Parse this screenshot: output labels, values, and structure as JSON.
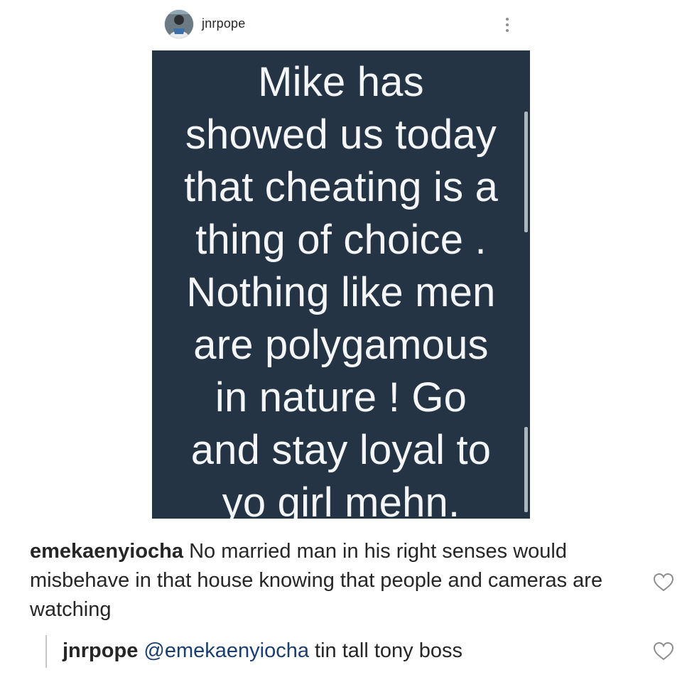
{
  "post": {
    "author": "jnrpope",
    "image_text": "Mike has\nshowed us today\nthat cheating is a\nthing of choice .\nNothing like men\nare polygamous\nin nature !  Go\nand stay loyal to\nyo girl mehn.",
    "image_background": "#243444"
  },
  "comments": [
    {
      "author": "emekaenyiocha",
      "text": "No married man in his right senses would misbehave in that house knowing that people and cameras are watching"
    }
  ],
  "reply": {
    "author": "jnrpope",
    "mention": "@emekaenyiocha",
    "text": "tin tall tony boss"
  },
  "icons": {
    "more": "more-vertical-icon",
    "like": "heart-outline-icon",
    "avatar": "profile-avatar"
  },
  "colors": {
    "text": "#262626",
    "mention": "#1a3f6e",
    "icon_gray": "#8e8e8e"
  }
}
